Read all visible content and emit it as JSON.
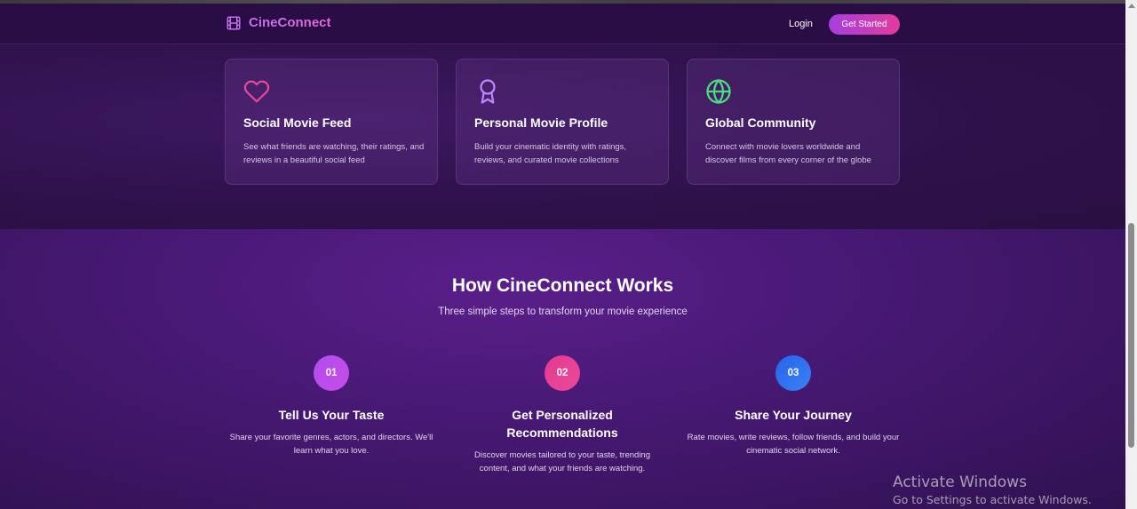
{
  "brand": {
    "name": "CineConnect",
    "icon": "film-icon"
  },
  "nav": {
    "login": "Login",
    "cta": "Get Started"
  },
  "features": [
    {
      "icon": "heart-icon",
      "title": "Social Movie Feed",
      "description": "See what friends are watching, their ratings, and reviews in a beautiful social feed"
    },
    {
      "icon": "award-icon",
      "title": "Personal Movie Profile",
      "description": "Build your cinematic identity with ratings, reviews, and curated movie collections"
    },
    {
      "icon": "globe-icon",
      "title": "Global Community",
      "description": "Connect with movie lovers worldwide and discover films from every corner of the globe"
    }
  ],
  "how": {
    "title": "How CineConnect Works",
    "subtitle": "Three simple steps to transform your movie experience",
    "steps": [
      {
        "number": "01",
        "title": "Tell Us Your Taste",
        "description": "Share your favorite genres, actors, and directors. We'll learn what you love."
      },
      {
        "number": "02",
        "title": "Get Personalized Recommendations",
        "description": "Discover movies tailored to your taste, trending content, and what your friends are watching."
      },
      {
        "number": "03",
        "title": "Share Your Journey",
        "description": "Rate movies, write reviews, follow friends, and build your cinematic social network."
      }
    ]
  },
  "colors": {
    "accent_purple": "#a855f7",
    "accent_pink": "#ec4899",
    "accent_blue": "#3b82f6",
    "heart_icon": "#ec4899",
    "award_icon": "#c084fc",
    "globe_icon": "#4ade80"
  },
  "watermark": {
    "title": "Activate Windows",
    "subtitle": "Go to Settings to activate Windows."
  }
}
